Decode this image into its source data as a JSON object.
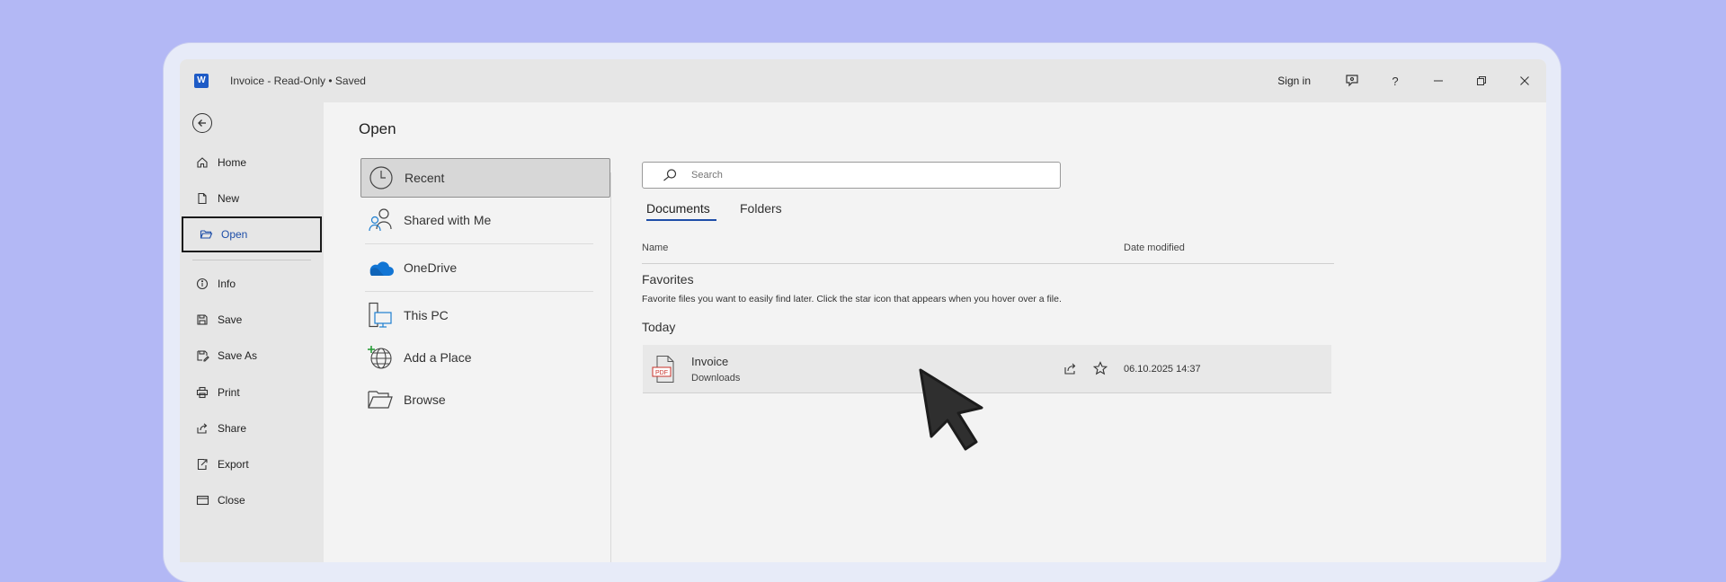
{
  "titlebar": {
    "doc_title": "Invoice  -  Read-Only • Saved",
    "sign_in": "Sign in",
    "help": "?"
  },
  "nav": {
    "items": [
      {
        "label": "Home",
        "icon": "home-icon"
      },
      {
        "label": "New",
        "icon": "new-document-icon"
      },
      {
        "label": "Open",
        "icon": "folder-open-icon",
        "active": true
      },
      {
        "label": "Info",
        "icon": "info-icon"
      },
      {
        "label": "Save",
        "icon": "save-icon"
      },
      {
        "label": "Save As",
        "icon": "save-as-icon"
      },
      {
        "label": "Print",
        "icon": "print-icon"
      },
      {
        "label": "Share",
        "icon": "share-icon"
      },
      {
        "label": "Export",
        "icon": "export-icon"
      },
      {
        "label": "Close",
        "icon": "close-document-icon"
      }
    ]
  },
  "main": {
    "title": "Open",
    "locations": [
      {
        "label": "Recent",
        "icon": "clock-icon",
        "selected": true
      },
      {
        "label": "Shared with Me",
        "icon": "shared-people-icon"
      },
      {
        "label": "OneDrive",
        "icon": "onedrive-cloud-icon"
      },
      {
        "label": "This PC",
        "icon": "this-pc-icon"
      },
      {
        "label": "Add a Place",
        "icon": "globe-add-icon"
      },
      {
        "label": "Browse",
        "icon": "browse-folder-icon"
      }
    ]
  },
  "search": {
    "placeholder": "Search"
  },
  "tabs": [
    {
      "label": "Documents",
      "active": true
    },
    {
      "label": "Folders",
      "active": false
    }
  ],
  "columns": {
    "name": "Name",
    "date": "Date modified"
  },
  "favorites": {
    "title": "Favorites",
    "description": "Favorite files you want to easily find later. Click the star icon that appears when you hover over a file."
  },
  "today": {
    "title": "Today",
    "files": [
      {
        "name": "Invoice",
        "location": "Downloads",
        "date": "06.10.2025 14:37",
        "icon": "pdf-file-icon"
      }
    ]
  },
  "colors": {
    "background": "#b3b8f5",
    "accent": "#1e4ea8",
    "word_brand": "#1e5bc6"
  }
}
